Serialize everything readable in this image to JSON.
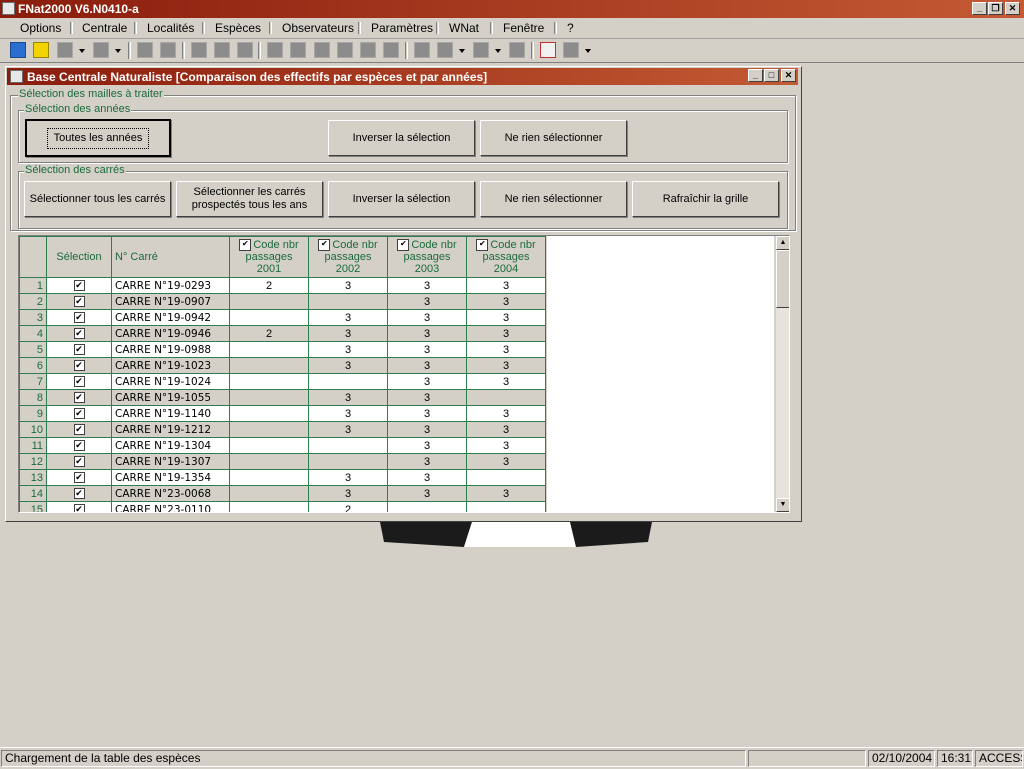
{
  "app": {
    "title": "FNat2000 V6.N0410-a"
  },
  "menu": [
    "Options",
    "Centrale",
    "Localités",
    "Espèces",
    "Observateurs",
    "Paramètres",
    "WNat",
    "Fenêtre",
    "?"
  ],
  "toolbar": {
    "icons": [
      "refresh-icon",
      "alert-icon",
      "tool-icon",
      "tool-dropdown-icon",
      "tool-icon",
      "tool-dropdown-icon",
      "tool-icon",
      "tool-icon",
      "pen-icon",
      "tool-icon",
      "tool-icon",
      "doc-icon",
      "doc-icon",
      "doc-icon",
      "doc-icon",
      "doc-icon",
      "doc-icon",
      "tool-icon",
      "tool-icon",
      "tool-icon",
      "tool-icon",
      "exit-icon",
      "tool-icon"
    ]
  },
  "dialog": {
    "title": "Base Centrale Naturaliste [Comparaison des effectifs par espèces et par années]",
    "group_mailles": "Sélection des mailles à traiter",
    "group_annees": "Sélection des années",
    "btn_toutes_annees": "Toutes les années",
    "btn_inverser_annees": "Inverser la sélection",
    "btn_rien_annees": "Ne rien sélectionner",
    "group_carres": "Sélection des carrés",
    "btn_tous_carres": "Sélectionner tous les carrés",
    "btn_prospectes_line1": "Sélectionner les carrés",
    "btn_prospectes_line2": "prospectés tous les ans",
    "btn_inverser_carres": "Inverser la sélection",
    "btn_rien_carres": "Ne rien sélectionner",
    "btn_rafraichir": "Rafraîchir la grille"
  },
  "grid": {
    "col_selection": "Sélection",
    "col_carre": "N° Carré",
    "year_cols": [
      {
        "l1": "Code nbr",
        "l2": "passages",
        "year": "2001",
        "checked": true
      },
      {
        "l1": "Code nbr",
        "l2": "passages",
        "year": "2002",
        "checked": true
      },
      {
        "l1": "Code nbr",
        "l2": "passages",
        "year": "2003",
        "checked": true
      },
      {
        "l1": "Code nbr",
        "l2": "passages",
        "year": "2004",
        "checked": true
      }
    ],
    "rows": [
      {
        "n": "1",
        "carre": "CARRE N°19-0293",
        "v": [
          "2",
          "3",
          "3",
          "3"
        ]
      },
      {
        "n": "2",
        "carre": "CARRE N°19-0907",
        "v": [
          "",
          "",
          "3",
          "3"
        ]
      },
      {
        "n": "3",
        "carre": "CARRE N°19-0942",
        "v": [
          "",
          "3",
          "3",
          "3"
        ]
      },
      {
        "n": "4",
        "carre": "CARRE N°19-0946",
        "v": [
          "2",
          "3",
          "3",
          "3"
        ]
      },
      {
        "n": "5",
        "carre": "CARRE N°19-0988",
        "v": [
          "",
          "3",
          "3",
          "3"
        ]
      },
      {
        "n": "6",
        "carre": "CARRE N°19-1023",
        "v": [
          "",
          "3",
          "3",
          "3"
        ]
      },
      {
        "n": "7",
        "carre": "CARRE N°19-1024",
        "v": [
          "",
          "",
          "3",
          "3"
        ]
      },
      {
        "n": "8",
        "carre": "CARRE N°19-1055",
        "v": [
          "",
          "3",
          "3",
          ""
        ]
      },
      {
        "n": "9",
        "carre": "CARRE N°19-1140",
        "v": [
          "",
          "3",
          "3",
          "3"
        ]
      },
      {
        "n": "10",
        "carre": "CARRE N°19-1212",
        "v": [
          "",
          "3",
          "3",
          "3"
        ]
      },
      {
        "n": "11",
        "carre": "CARRE N°19-1304",
        "v": [
          "",
          "",
          "3",
          "3"
        ]
      },
      {
        "n": "12",
        "carre": "CARRE N°19-1307",
        "v": [
          "",
          "",
          "3",
          "3"
        ]
      },
      {
        "n": "13",
        "carre": "CARRE N°19-1354",
        "v": [
          "",
          "3",
          "3",
          ""
        ]
      },
      {
        "n": "14",
        "carre": "CARRE N°23-0068",
        "v": [
          "",
          "3",
          "3",
          "3"
        ]
      },
      {
        "n": "15",
        "carre": "CARRE N°23-0110",
        "v": [
          "",
          "2",
          "",
          ""
        ]
      }
    ]
  },
  "status": {
    "message": "Chargement de la table des espèces",
    "date": "02/10/2004",
    "time": "16:31",
    "mode": "ACCESS"
  }
}
